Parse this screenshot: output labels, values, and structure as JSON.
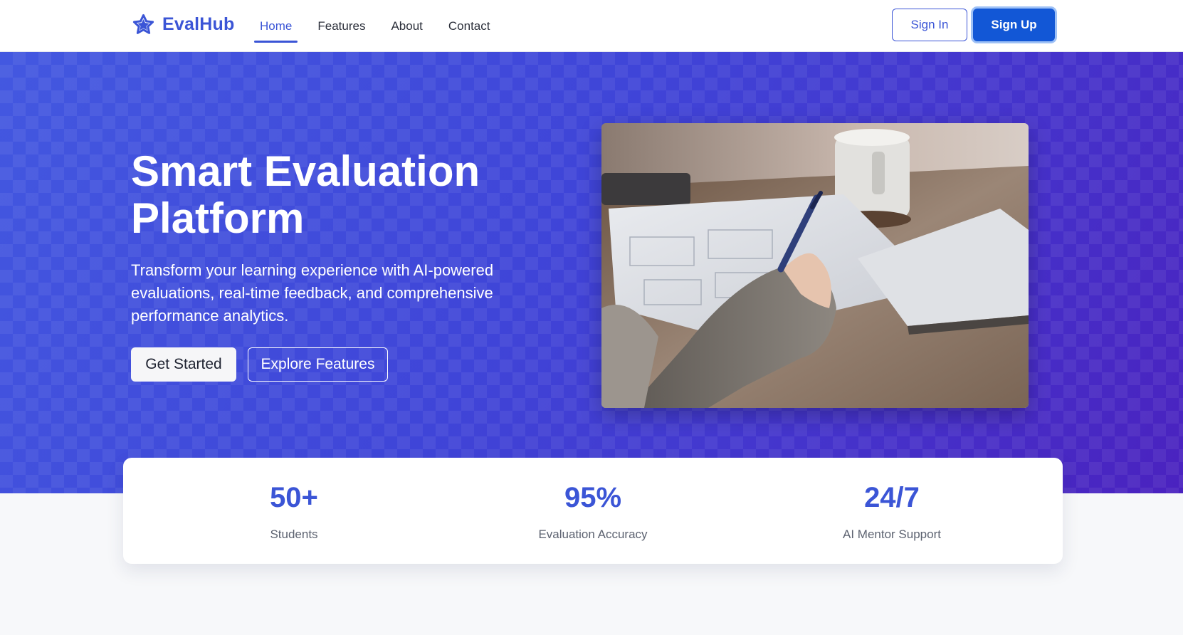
{
  "brand": {
    "name": "EvalHub",
    "icon": "star-icon",
    "color": "#3b55d6"
  },
  "nav": {
    "links": [
      {
        "label": "Home",
        "active": true
      },
      {
        "label": "Features",
        "active": false
      },
      {
        "label": "About",
        "active": false
      },
      {
        "label": "Contact",
        "active": false
      }
    ],
    "signin_label": "Sign In",
    "signup_label": "Sign Up"
  },
  "hero": {
    "title_line1": "Smart Evaluation",
    "title_line2": "Platform",
    "subtitle": "Transform your learning experience with AI-powered evaluations, real-time feedback, and comprehensive performance analytics.",
    "primary_cta": "Get Started",
    "secondary_cta": "Explore Features",
    "image": "person-writing-photo"
  },
  "stats": [
    {
      "value": "50+",
      "label": "Students"
    },
    {
      "value": "95%",
      "label": "Evaluation Accuracy"
    },
    {
      "value": "24/7",
      "label": "AI Mentor Support"
    }
  ],
  "colors": {
    "accent": "#3b55d6",
    "signup_bg": "#1257d6",
    "hero_gradient_start": "#4358e0",
    "hero_gradient_end": "#4a22bf"
  }
}
